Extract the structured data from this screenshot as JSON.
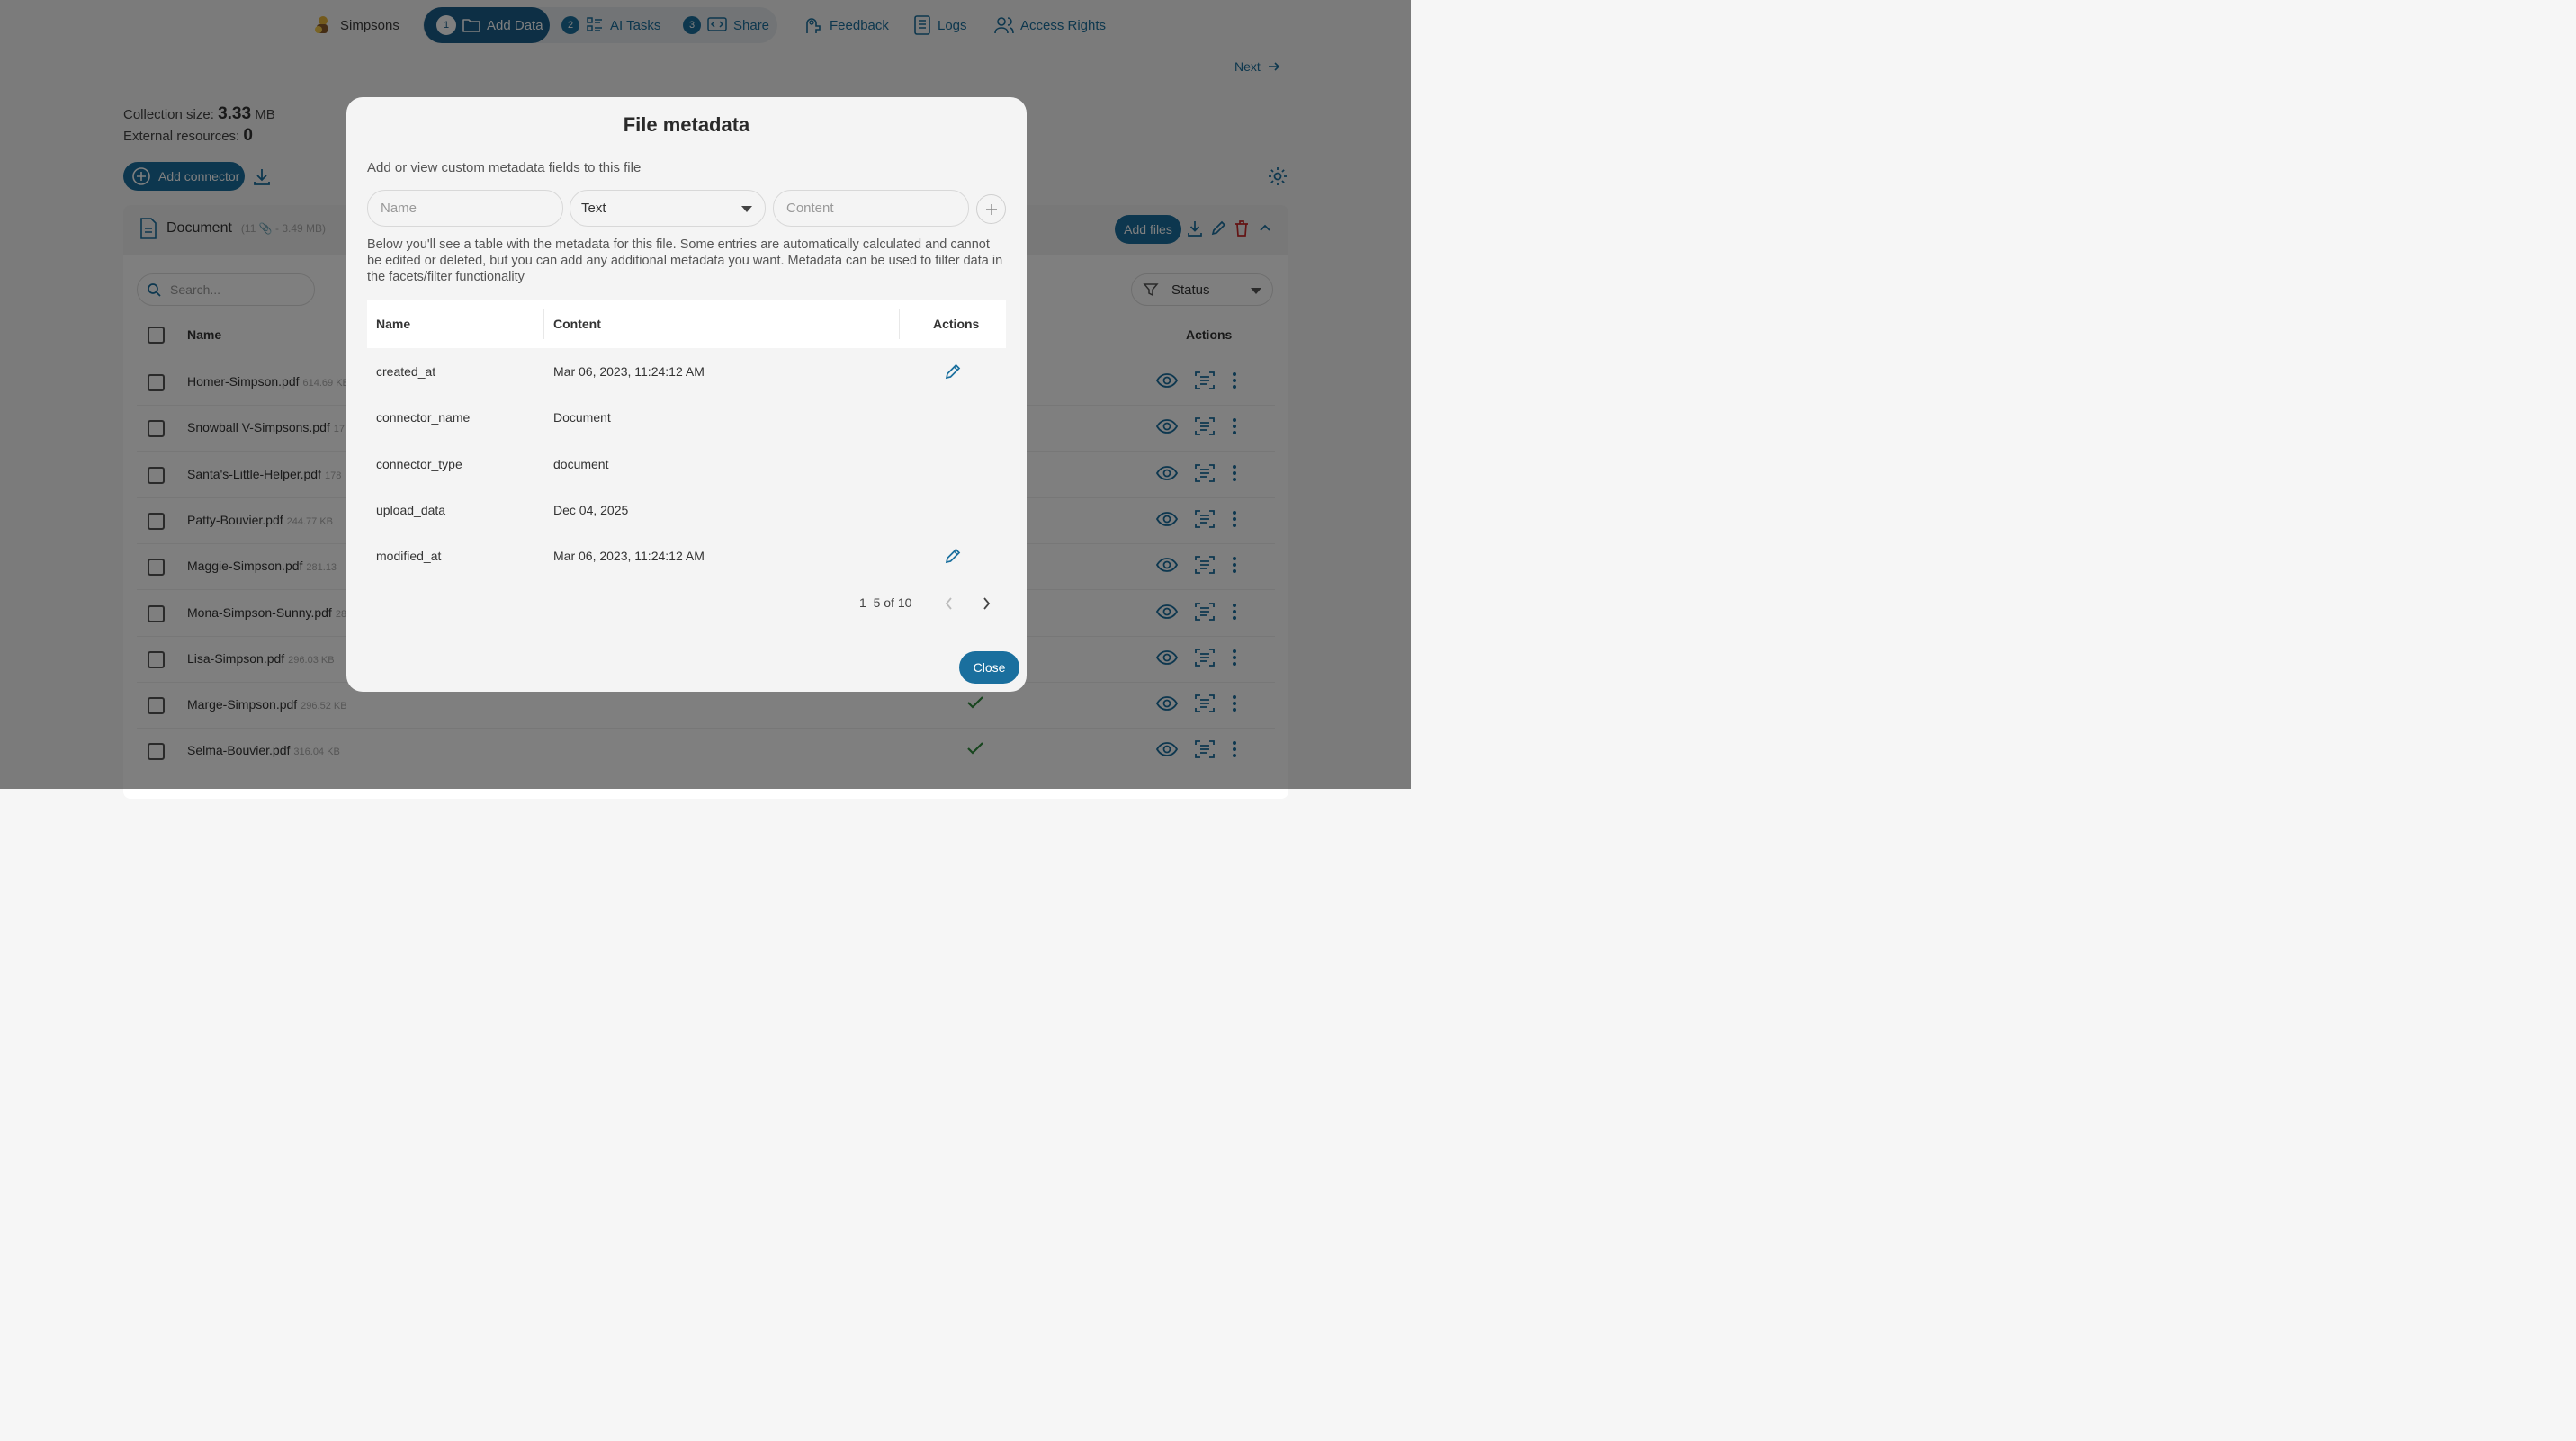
{
  "nav": {
    "project": "Simpsons",
    "steps": [
      {
        "num": "1",
        "label": "Add Data"
      },
      {
        "num": "2",
        "label": "AI Tasks"
      },
      {
        "num": "3",
        "label": "Share"
      }
    ],
    "feedback": "Feedback",
    "logs": "Logs",
    "access": "Access Rights"
  },
  "next_label": "Next",
  "stats": {
    "collection_label": "Collection size:",
    "collection_value": "3.33",
    "collection_unit": "MB",
    "external_label": "External resources:",
    "external_value": "0"
  },
  "add_connector": "Add connector",
  "panel": {
    "doc_title": "Document",
    "doc_meta": "(11 📎 - 3.49 MB)",
    "add_files": "Add files",
    "search_placeholder": "Search...",
    "status_filter": "Status",
    "col_name": "Name",
    "col_actions": "Actions",
    "rows": [
      {
        "name": "Homer-Simpson.pdf",
        "size": "614.69 KB"
      },
      {
        "name": "Snowball V-Simpsons.pdf",
        "size": "17"
      },
      {
        "name": "Santa's-Little-Helper.pdf",
        "size": "178"
      },
      {
        "name": "Patty-Bouvier.pdf",
        "size": "244.77 KB"
      },
      {
        "name": "Maggie-Simpson.pdf",
        "size": "281.13"
      },
      {
        "name": "Mona-Simpson-Sunny.pdf",
        "size": "28"
      },
      {
        "name": "Lisa-Simpson.pdf",
        "size": "296.03 KB"
      },
      {
        "name": "Marge-Simpson.pdf",
        "size": "296.52 KB"
      },
      {
        "name": "Selma-Bouvier.pdf",
        "size": "316.04 KB"
      }
    ]
  },
  "modal": {
    "title": "File metadata",
    "subtitle": "Add or view custom metadata fields to this file",
    "name_placeholder": "Name",
    "type_value": "Text",
    "content_placeholder": "Content",
    "description": "Below you'll see a table with the metadata for this file. Some entries are automatically calculated and cannot be edited or deleted, but you can add any additional metadata you want. Metadata can be used to filter data in the facets/filter functionality",
    "col_name": "Name",
    "col_content": "Content",
    "col_actions": "Actions",
    "rows": [
      {
        "name": "created_at",
        "content": "Mar 06, 2023, 11:24:12 AM",
        "editable": true
      },
      {
        "name": "connector_name",
        "content": "Document",
        "editable": false
      },
      {
        "name": "connector_type",
        "content": "document",
        "editable": false
      },
      {
        "name": "upload_data",
        "content": "Dec 04, 2025",
        "editable": false
      },
      {
        "name": "modified_at",
        "content": "Mar 06, 2023, 11:24:12 AM",
        "editable": true
      }
    ],
    "pagination": "1–5 of 10",
    "close_label": "Close"
  },
  "colors": {
    "accent": "#1a6f9e",
    "accent_dark": "#1a5f8a",
    "check_green": "#2e8b3d",
    "delete_red": "#c62828"
  }
}
